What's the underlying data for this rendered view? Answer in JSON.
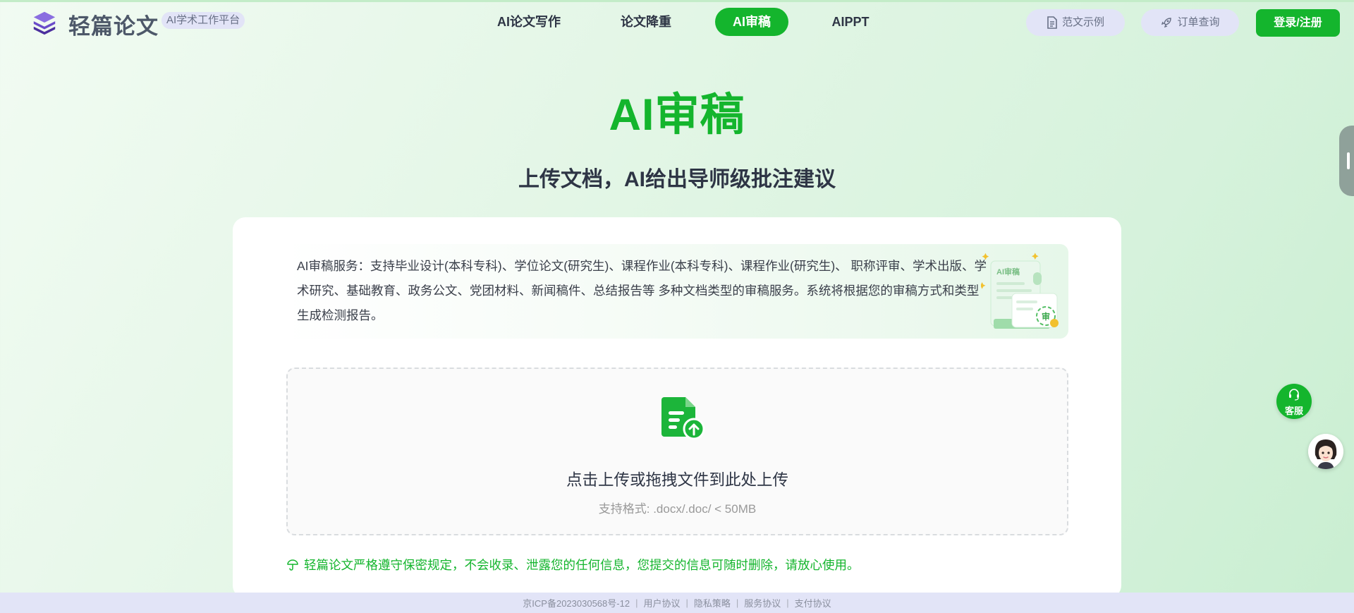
{
  "header": {
    "brand": "轻篇论文",
    "brand_tag": "AI学术工作平台",
    "nav": [
      "AI论文写作",
      "论文降重",
      "AI审稿",
      "AIPPT"
    ],
    "active_nav_index": 2,
    "sample_button": "范文示例",
    "order_button": "订单查询",
    "login_button": "登录/注册"
  },
  "hero": {
    "title": "AI审稿",
    "subtitle": "上传文档，AI给出导师级批注建议"
  },
  "description": {
    "text": "AI审稿服务：支持毕业设计(本科专科)、学位论文(研究生)、课程作业(本科专科)、课程作业(研究生)、 职称评审、学术出版、学术研究、基础教育、政务公文、党团材料、新闻稿件、总结报告等 多种文档类型的审稿服务。系统将根据您的审稿方式和类型生成检测报告。",
    "illustration_label": "AI审稿",
    "illustration_badge": "审"
  },
  "upload": {
    "main_text": "点击上传或拖拽文件到此处上传",
    "hint": "支持格式: .docx/.doc/ < 50MB"
  },
  "privacy_text": "轻篇论文严格遵守保密规定，不会收录、泄露您的任何信息，您提交的信息可随时删除，请放心使用。",
  "footer": {
    "icp": "京ICP备2023030568号-12",
    "links": [
      "用户协议",
      "隐私策略",
      "服务协议",
      "支付协议"
    ]
  },
  "float": {
    "service_label": "客服"
  },
  "colors": {
    "accent": "#14b52d",
    "pill_bg": "#e2e4f7",
    "text_dark": "#2e3545"
  },
  "icons": [
    "logo-layers-icon",
    "document-icon",
    "rocket-icon",
    "upload-file-icon",
    "shield-icon",
    "headset-icon",
    "assistant-avatar"
  ]
}
